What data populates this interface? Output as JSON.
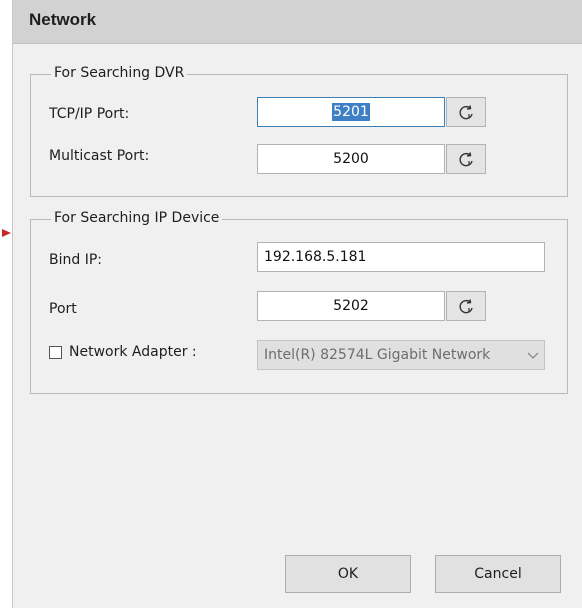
{
  "dialog": {
    "title": "Network"
  },
  "searching_dvr": {
    "legend": "For Searching DVR",
    "tcp_ip_port_label": "TCP/IP Port:",
    "tcp_ip_port_value": "5201",
    "multicast_port_label": "Multicast Port:",
    "multicast_port_value": "5200"
  },
  "searching_ip_device": {
    "legend": "For Searching IP Device",
    "bind_ip_label": "Bind IP:",
    "bind_ip_value": "192.168.5.181",
    "port_label": "Port",
    "port_value": "5202",
    "network_adapter_label": "Network Adapter :",
    "network_adapter_checked": false,
    "network_adapter_value": "Intel(R) 82574L Gigabit Network"
  },
  "buttons": {
    "ok_label": "OK",
    "cancel_label": "Cancel"
  },
  "colors": {
    "selection": "#3f7fc4",
    "marker": "#c62828",
    "titlebar": "#d2d2d2"
  },
  "icons": {
    "reset": "refresh-icon",
    "dropdown": "chevron-down-icon"
  }
}
